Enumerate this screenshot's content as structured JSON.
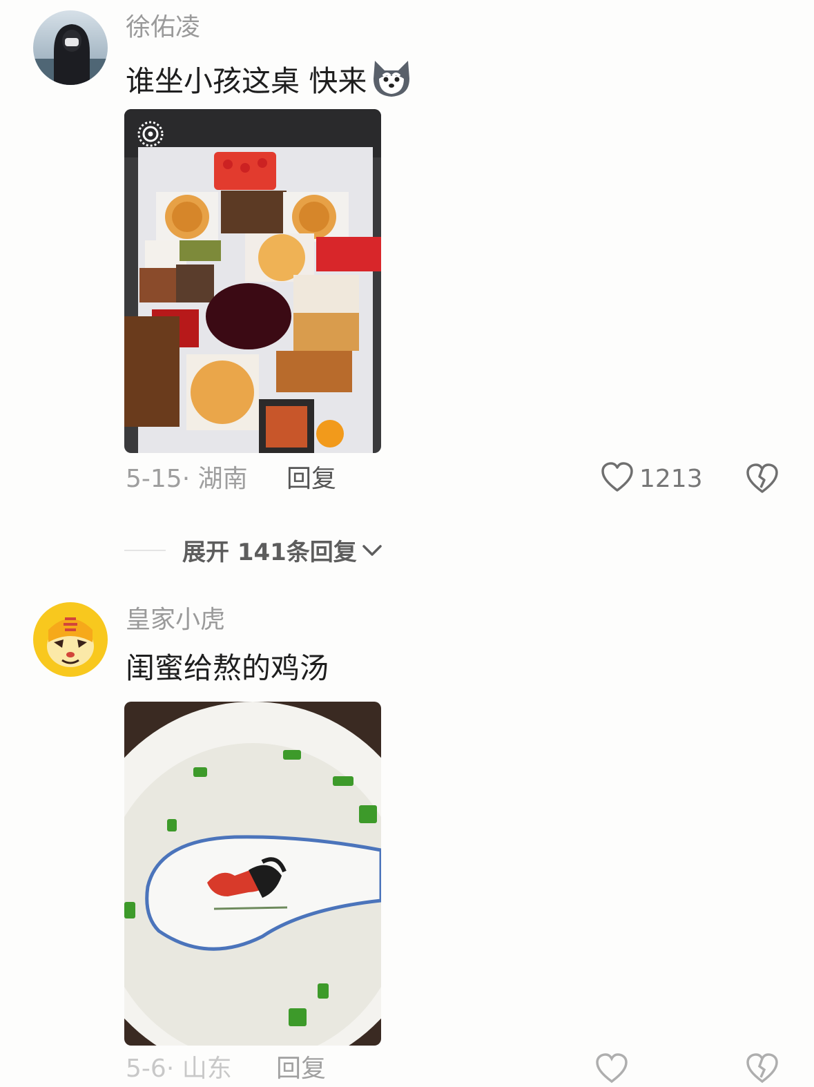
{
  "comments": [
    {
      "username": "徐佑凌",
      "text": "谁坐小孩这桌 快来",
      "emoji": "husky-emoji",
      "date": "5-15",
      "sep": "·",
      "location": "湖南",
      "reply": "回复",
      "likes": "1213"
    },
    {
      "username": "皇家小虎",
      "text": "闺蜜给熬的鸡汤",
      "date": "5-6",
      "sep": "·",
      "location": "山东",
      "reply": "回复"
    }
  ],
  "expand_replies": {
    "label": "展开 141条回复",
    "icon": "chevron-down-icon"
  },
  "colors": {
    "meta": "#9e9e9e",
    "text": "#1e1e1e",
    "bg": "#fdfdfc"
  }
}
